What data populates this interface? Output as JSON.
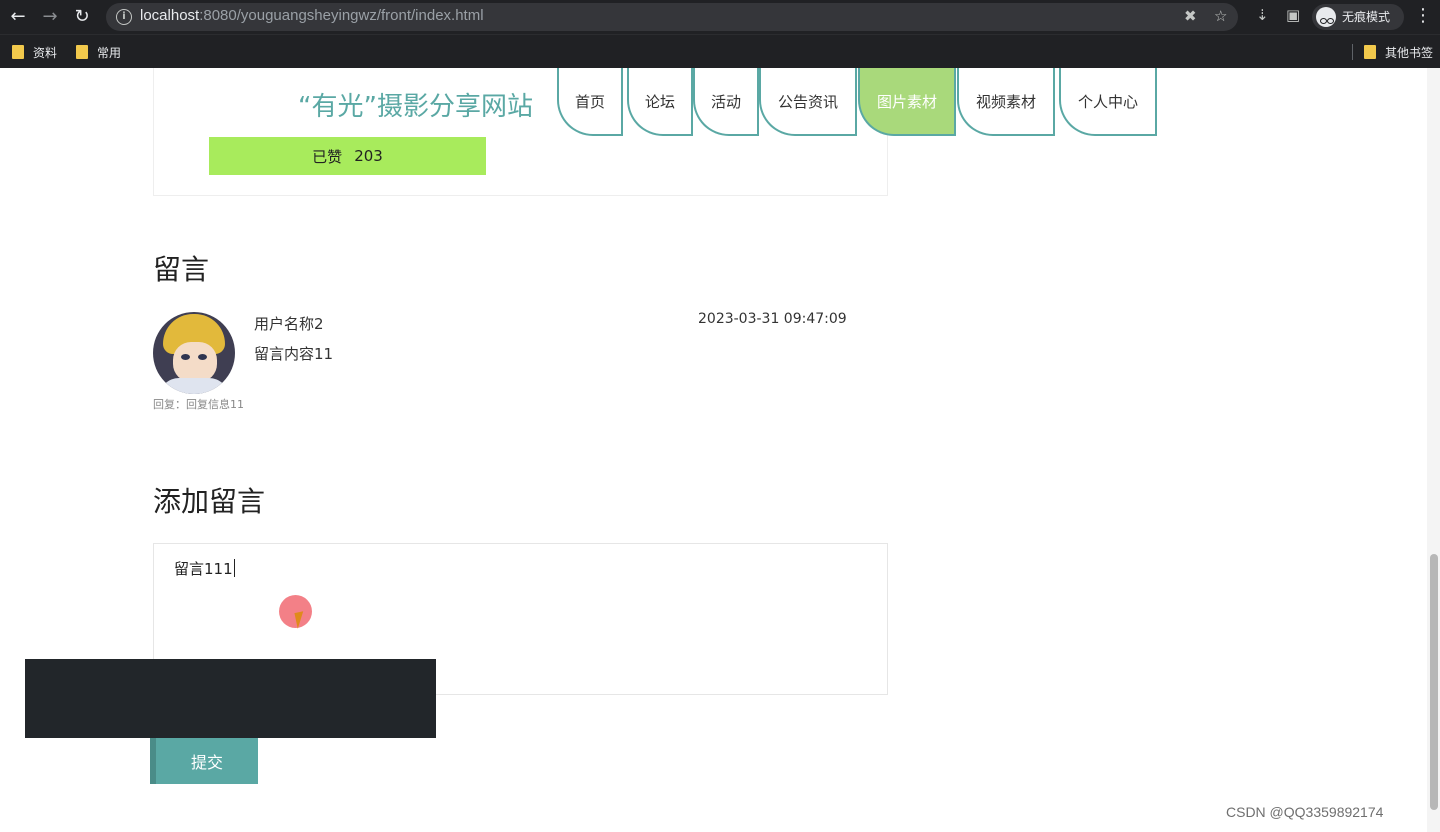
{
  "browser": {
    "url_host": "localhost",
    "url_rest": ":8080/youguangsheyingwz/front/index.html",
    "incognito_label": "无痕模式",
    "bookmarks": [
      "资料",
      "常用"
    ],
    "other_bookmarks": "其他书签"
  },
  "site": {
    "title": "“有光”摄影分享网站",
    "nav": [
      "首页",
      "论坛",
      "活动",
      "公告资讯",
      "图片素材",
      "视频素材",
      "个人中心"
    ],
    "active_nav": "图片素材",
    "accent_color": "#5aa8a4",
    "active_color": "#a9d97b"
  },
  "like": {
    "label": "已赞",
    "count": "203"
  },
  "comments": {
    "title": "留言",
    "items": [
      {
        "username": "用户名称2",
        "timestamp": "2023-03-31 09:47:09",
        "content": "留言内容11",
        "reply": "回复：回复信息11"
      }
    ]
  },
  "add_comment": {
    "title": "添加留言",
    "value": "留言111",
    "submit_label": "提交"
  },
  "watermark": "CSDN @QQ3359892174"
}
